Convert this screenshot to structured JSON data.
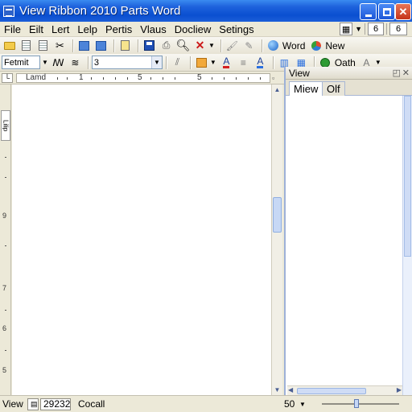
{
  "window": {
    "title": "View Ribbon 2010 Parts Word"
  },
  "menu": {
    "items": [
      "File",
      "Eilt",
      "Lert",
      "Lelp",
      "Pertis",
      "Vlaus",
      "Docliew",
      "Setings"
    ],
    "right_value": "6",
    "right_value2": "6"
  },
  "toolbar1": {
    "word_label": "Word",
    "new_label": "New"
  },
  "toolbar2": {
    "font_value": "Fetmit",
    "size_value": "3",
    "oath_label": "Oath"
  },
  "ruler": {
    "label": "Lamd",
    "numbers": [
      "1",
      "5",
      "5"
    ]
  },
  "vruler": {
    "label": "Lilip",
    "numbers": [
      "9",
      "7",
      "6",
      "5"
    ]
  },
  "pane": {
    "title": "View",
    "tab_active": "Miew",
    "tab_inactive": "Olf"
  },
  "status": {
    "view_label": "View",
    "number_value": "29232",
    "position_label": "Cocall",
    "zoom_value": "50"
  }
}
